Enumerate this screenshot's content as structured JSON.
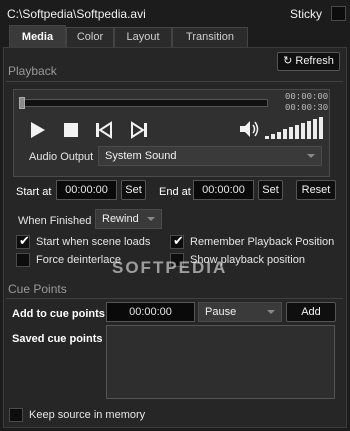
{
  "window": {
    "title": "C:\\Softpedia\\Softpedia.avi",
    "sticky_label": "Sticky"
  },
  "tabs": [
    {
      "label": "Media",
      "active": true
    },
    {
      "label": "Color",
      "active": false
    },
    {
      "label": "Layout",
      "active": false
    },
    {
      "label": "Transition",
      "active": false
    }
  ],
  "refresh_label": "Refresh",
  "playback": {
    "section_label": "Playback",
    "position_progress": 0.0,
    "current_time": "00:00:00",
    "total_time": "00:00:30",
    "audio_output_label": "Audio Output",
    "audio_output_value": "System Sound",
    "start_at_label": "Start at",
    "start_at_value": "00:00:00",
    "end_at_label": "End at",
    "end_at_value": "00:00:00",
    "set_label": "Set",
    "reset_label": "Reset",
    "when_finished_label": "When Finished",
    "when_finished_value": "Rewind",
    "options": [
      {
        "label": "Start when scene loads",
        "checked": true
      },
      {
        "label": "Remember Playback Position",
        "checked": true
      },
      {
        "label": "Force deinterlace",
        "checked": false
      },
      {
        "label": "Show playback position",
        "checked": false
      }
    ]
  },
  "cue_points": {
    "section_label": "Cue Points",
    "add_label": "Add to cue points",
    "time_value": "00:00:00",
    "action_value": "Pause",
    "add_button": "Add",
    "saved_label": "Saved cue points"
  },
  "keep_source_label": "Keep source in memory",
  "keep_source_checked": false,
  "watermark": "SOFTPEDIA",
  "colors": {
    "background": "#1c1c1c",
    "panel": "#262626",
    "button": "#0f0f0f"
  }
}
